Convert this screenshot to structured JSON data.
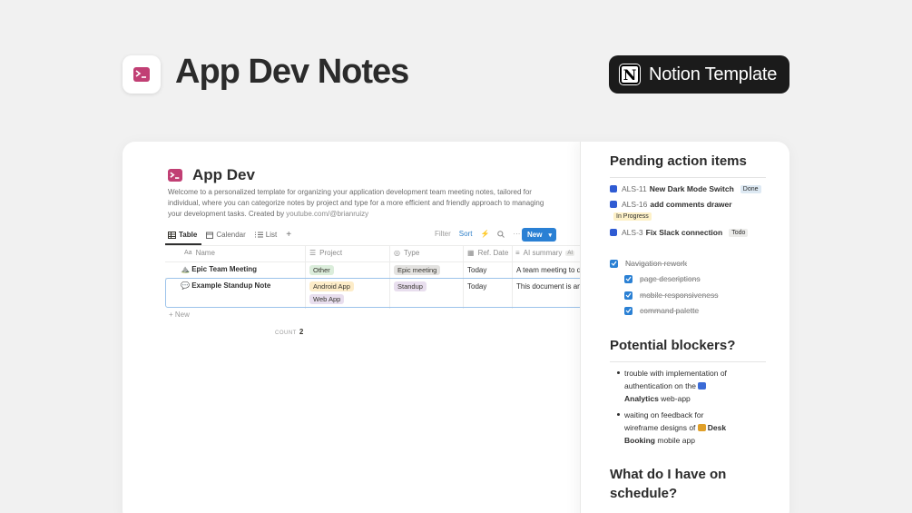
{
  "hero": {
    "title": "App Dev Notes",
    "badge_text": "Notion Template",
    "badge_logo": "N"
  },
  "page": {
    "title": "App Dev",
    "description_prefix": "Welcome to a personalized template for organizing your application development team meeting notes, tailored for individual, where you can categorize notes by project and type for a more efficient and friendly approach to managing your development tasks. Created by ",
    "description_link": "youtube.com/@brianruizy"
  },
  "views": {
    "tabs": [
      "Table",
      "Calendar",
      "List"
    ],
    "add": "+",
    "filter": "Filter",
    "sort": "Sort",
    "new_button": "New"
  },
  "table": {
    "columns": [
      "Name",
      "Project",
      "Type",
      "Ref. Date",
      "AI summary"
    ],
    "ai_badge": "AI",
    "rows": [
      {
        "icon": "⛰️",
        "name": "Epic Team Meeting",
        "projects": [
          "Other"
        ],
        "type": "Epic meeting",
        "date": "Today",
        "summary": "A team meeting to d"
      },
      {
        "icon": "💬",
        "name": "Example Standup Note",
        "projects": [
          "Android App",
          "Web App"
        ],
        "type": "Standup",
        "date": "Today",
        "summary": "This document is an"
      }
    ],
    "new_row": "New",
    "count_label": "COUNT",
    "count_value": "2"
  },
  "side": {
    "pending_title": "Pending action items",
    "actions": [
      {
        "key": "ALS-11",
        "title": "New Dark Mode Switch",
        "status": "Done"
      },
      {
        "key": "ALS-16",
        "title": "add comments drawer",
        "status": "In Progress"
      },
      {
        "key": "ALS-3",
        "title": "Fix Slack connection",
        "status": "Todo"
      }
    ],
    "checklist": {
      "parent": "Navigation rework",
      "children": [
        "page descriptions",
        "mobile responsiveness",
        "command palette"
      ]
    },
    "blockers_title": "Potential blockers?",
    "blockers": [
      {
        "pre": "trouble with implementation of authentication on the",
        "app": "Analytics",
        "post": "web-app"
      },
      {
        "pre": "waiting on feedback for wireframe designs of",
        "app": "Desk Booking",
        "post": "mobile app"
      }
    ],
    "schedule_title": "What do I have on schedule?"
  }
}
